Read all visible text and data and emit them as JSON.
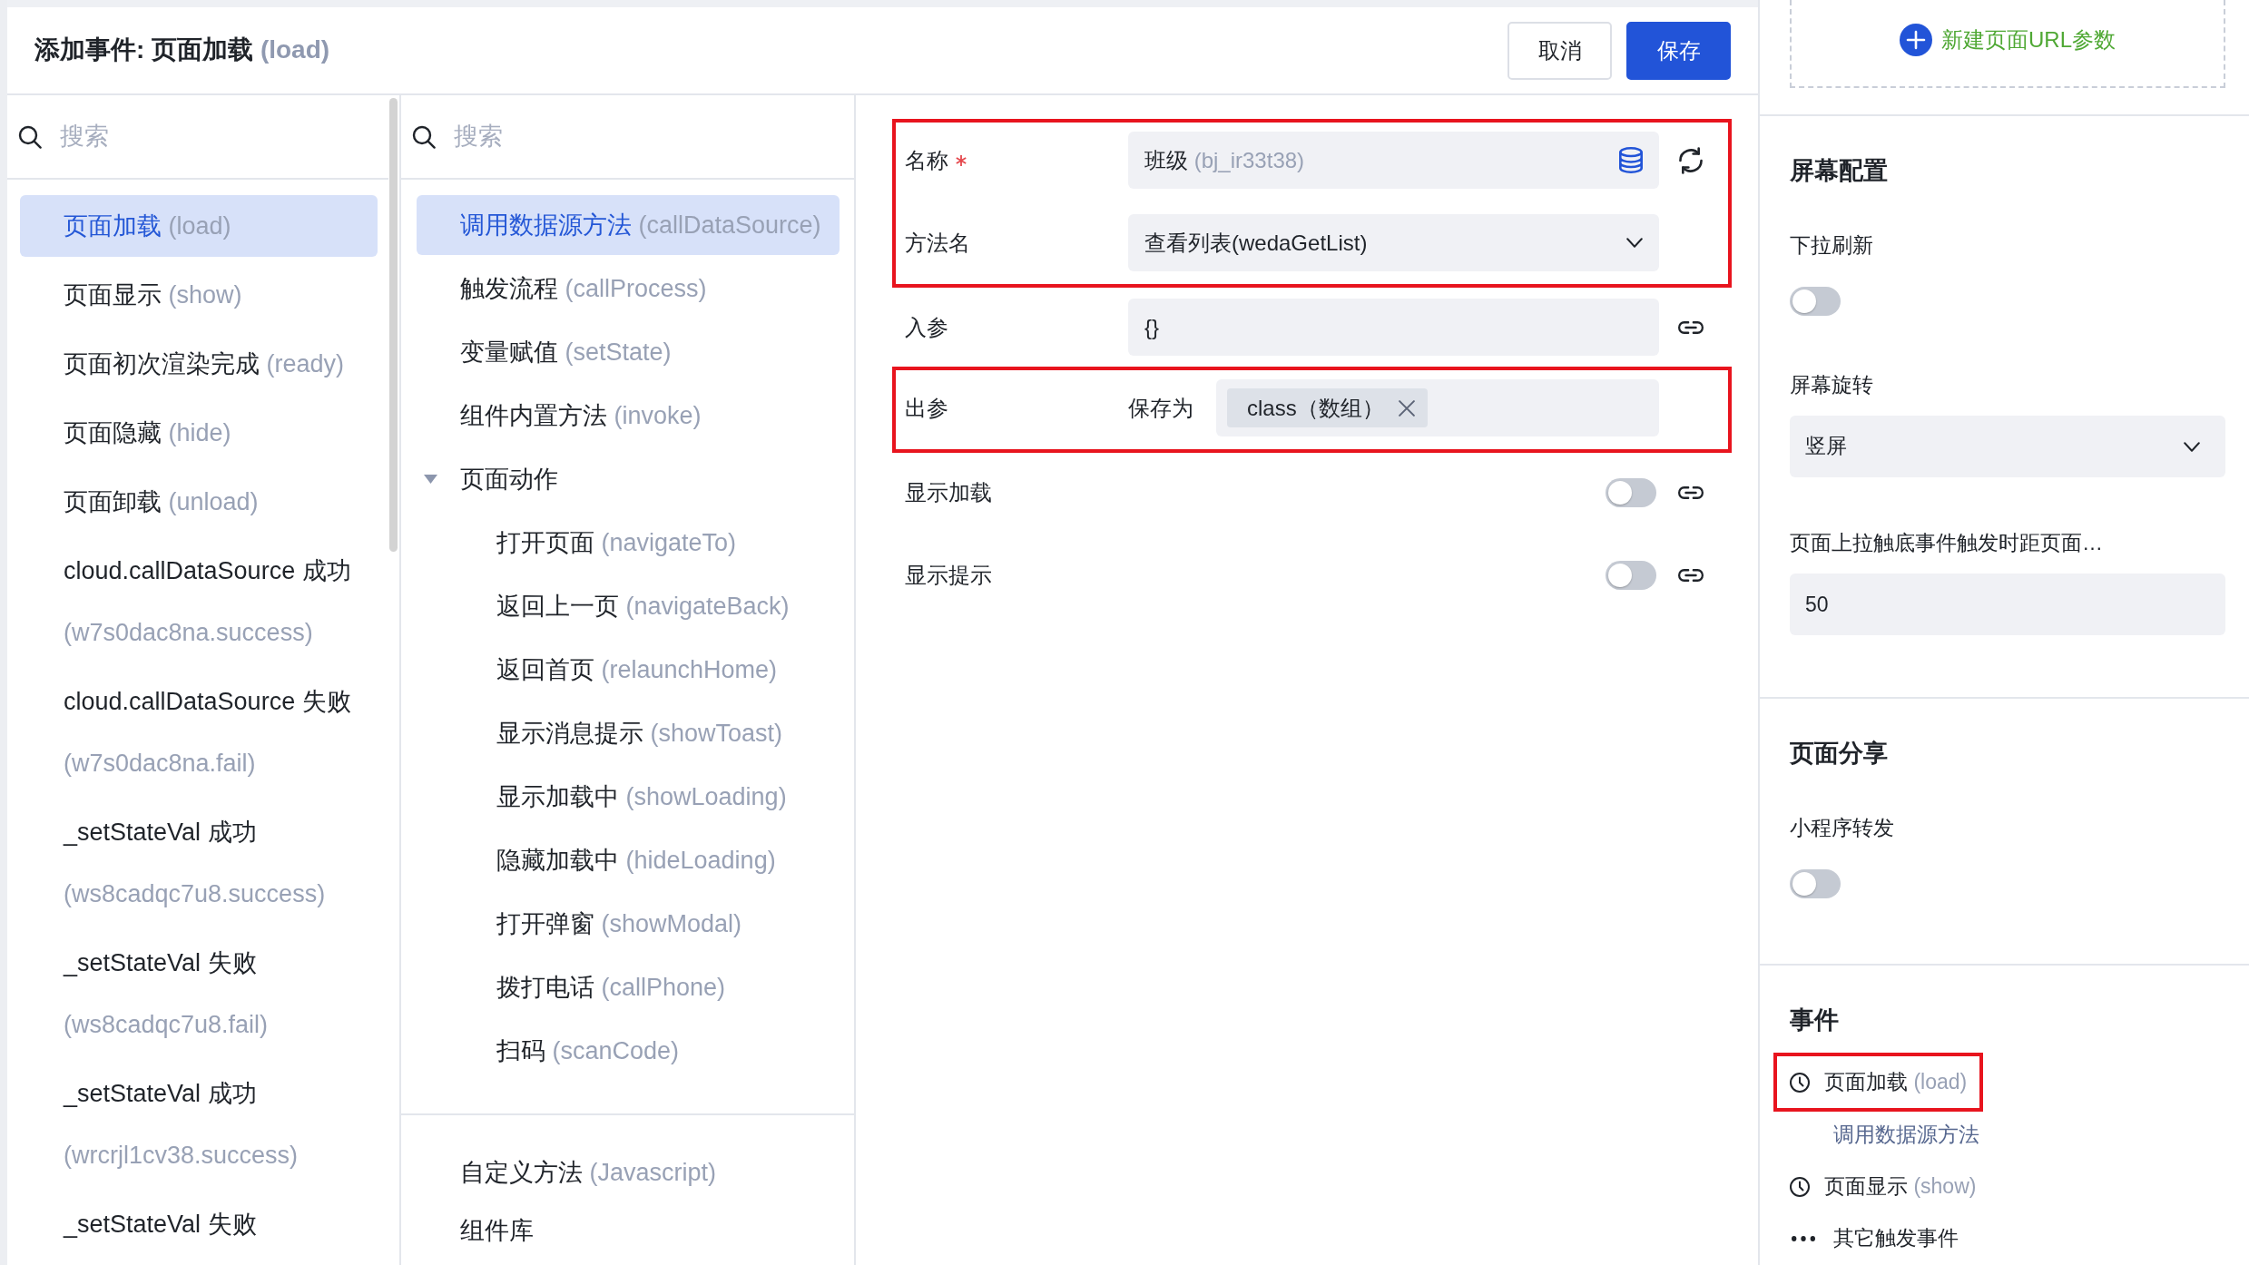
{
  "header": {
    "title": "添加事件: 页面加载",
    "code": "(load)",
    "buttons": [
      {
        "label": "取消",
        "kind": "cancel"
      },
      {
        "label": "保存",
        "kind": "save"
      }
    ]
  },
  "events_panel": {
    "search": {
      "placeholder": "搜索"
    },
    "items": [
      {
        "label": "页面加载",
        "code": "(load)",
        "selected": true
      },
      {
        "label": "页面显示",
        "code": "(show)",
        "selected": false
      },
      {
        "label": "页面初次渲染完成",
        "code": "(ready)",
        "selected": false
      },
      {
        "label": "页面隐藏",
        "code": "(hide)",
        "selected": false
      },
      {
        "label": "页面卸载",
        "code": "(unload)",
        "selected": false
      },
      {
        "label": "cloud.callDataSource 成功",
        "code": "(w7s0dac8na.success)",
        "selected": false
      },
      {
        "label": "cloud.callDataSource 失败",
        "code": "(w7s0dac8na.fail)",
        "selected": false
      },
      {
        "label": "_setStateVal 成功",
        "code": "(ws8cadqc7u8.success)",
        "selected": false
      },
      {
        "label": "_setStateVal 失败",
        "code": "(ws8cadqc7u8.fail)",
        "selected": false
      },
      {
        "label": "_setStateVal 成功",
        "code": "(wrcrjl1cv38.success)",
        "selected": false
      },
      {
        "label": "_setStateVal 失败",
        "selected": false
      }
    ]
  },
  "actions_panel": {
    "search": {
      "placeholder": "搜索"
    },
    "items": [
      {
        "label": "调用数据源方法",
        "code": "(callDataSource)",
        "selected": true
      },
      {
        "label": "触发流程",
        "code": "(callProcess)",
        "selected": false
      },
      {
        "label": "变量赋值",
        "code": "(setState)",
        "selected": false
      },
      {
        "label": "组件内置方法",
        "code": "(invoke)",
        "selected": false
      },
      {
        "label": "页面动作",
        "expanded": true,
        "selected": false,
        "children": [
          {
            "label": "打开页面",
            "code": "(navigateTo)",
            "selected": false
          },
          {
            "label": "返回上一页",
            "code": "(navigateBack)",
            "selected": false
          },
          {
            "label": "返回首页",
            "code": "(relaunchHome)",
            "selected": false
          },
          {
            "label": "显示消息提示",
            "code": "(showToast)",
            "selected": false
          },
          {
            "label": "显示加载中",
            "code": "(showLoading)",
            "selected": false
          },
          {
            "label": "隐藏加载中",
            "code": "(hideLoading)",
            "selected": false
          },
          {
            "label": "打开弹窗",
            "code": "(showModal)",
            "selected": false
          },
          {
            "label": "拨打电话",
            "code": "(callPhone)",
            "selected": false
          },
          {
            "label": "扫码",
            "code": "(scanCode)",
            "selected": false
          }
        ]
      }
    ],
    "extra_items": [
      {
        "label": "自定义方法",
        "code": "(Javascript)",
        "selected": false
      },
      {
        "label": "组件库",
        "selected": false
      }
    ]
  },
  "form": {
    "sections": [
      {
        "highlighted": true,
        "rows": [
          {
            "kind": "datasource",
            "label": "名称",
            "required": true,
            "value": "班级",
            "code": "(bj_ir33t38)"
          },
          {
            "kind": "select",
            "label": "方法名",
            "value": "查看列表(wedaGetList)"
          }
        ]
      },
      {
        "highlighted": false,
        "rows": [
          {
            "kind": "input",
            "label": "入参",
            "value": "{}"
          }
        ]
      },
      {
        "highlighted": true,
        "rows": [
          {
            "kind": "output",
            "label": "出参",
            "prefix": "保存为",
            "tags": [
              "class（数组）"
            ]
          }
        ]
      },
      {
        "highlighted": false,
        "rows": [
          {
            "kind": "toggle",
            "label": "显示加载",
            "on": false
          },
          {
            "kind": "toggle",
            "label": "显示提示",
            "on": false
          }
        ]
      }
    ]
  },
  "right_panel": {
    "add_param_button": {
      "label": "新建页面URL参数"
    },
    "sections": [
      {
        "title": "屏幕配置",
        "fields": [
          {
            "kind": "toggle",
            "label": "下拉刷新",
            "on": false
          },
          {
            "kind": "select",
            "label": "屏幕旋转",
            "value": "竖屏"
          },
          {
            "kind": "input",
            "label": "页面上拉触底事件触发时距页面…",
            "value": "50"
          }
        ]
      },
      {
        "title": "页面分享",
        "fields": [
          {
            "kind": "toggle",
            "label": "小程序转发",
            "on": false
          }
        ]
      }
    ],
    "events": {
      "title": "事件",
      "items": [
        {
          "label": "页面加载",
          "code": "(load)",
          "highlighted": true,
          "actions": [
            "调用数据源方法"
          ]
        },
        {
          "label": "页面显示",
          "code": "(show)",
          "highlighted": false
        }
      ],
      "more": {
        "label": "其它触发事件"
      }
    }
  }
}
